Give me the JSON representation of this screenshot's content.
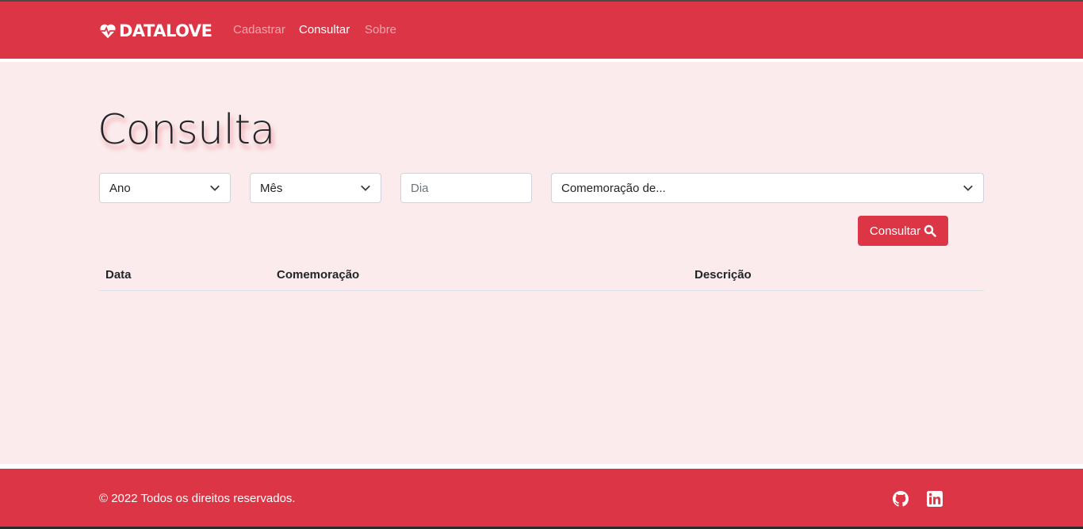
{
  "navbar": {
    "brand": "DATALOVE",
    "brand_icon": "heart-pulse-icon",
    "links": [
      {
        "label": "Cadastrar",
        "active": false
      },
      {
        "label": "Consultar",
        "active": true
      },
      {
        "label": "Sobre",
        "active": false
      }
    ],
    "accent_color": "#dc3545"
  },
  "main": {
    "title": "Consulta",
    "filters": {
      "ano": "Ano",
      "mes": "Mês",
      "dia_placeholder": "Dia",
      "comemoracao": "Comemoração de..."
    },
    "search_button": "Consultar",
    "table": {
      "columns": [
        "Data",
        "Comemoração",
        "Descrição"
      ],
      "rows": []
    },
    "background_color": "#fbebec"
  },
  "footer": {
    "copyright": "© 2022 Todos os direitos reservados.",
    "social_icons": [
      "github-icon",
      "linkedin-icon"
    ]
  }
}
